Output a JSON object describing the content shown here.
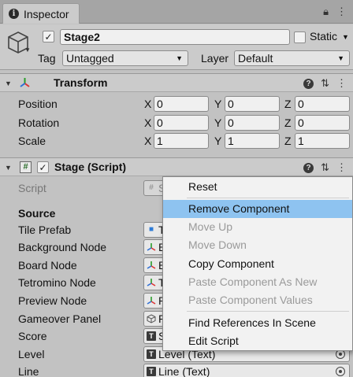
{
  "window": {
    "tab_label": "Inspector"
  },
  "gameobject": {
    "name": "Stage2",
    "active": true,
    "static_label": "Static",
    "tag_label": "Tag",
    "tag_value": "Untagged",
    "layer_label": "Layer",
    "layer_value": "Default"
  },
  "transform": {
    "title": "Transform",
    "rows": [
      {
        "label": "Position",
        "x": "0",
        "y": "0",
        "z": "0"
      },
      {
        "label": "Rotation",
        "x": "0",
        "y": "0",
        "z": "0"
      },
      {
        "label": "Scale",
        "x": "1",
        "y": "1",
        "z": "1"
      }
    ],
    "axes": {
      "x": "X",
      "y": "Y",
      "z": "Z"
    }
  },
  "stage_script": {
    "title": "Stage (Script)",
    "script_label": "Script",
    "script_value": "S",
    "section": "Source",
    "props": [
      {
        "label": "Tile Prefab",
        "value": "T",
        "icon": "prefab-cube-icon"
      },
      {
        "label": "Background Node",
        "value": "B",
        "icon": "transform-icon"
      },
      {
        "label": "Board Node",
        "value": "B",
        "icon": "transform-icon"
      },
      {
        "label": "Tetromino Node",
        "value": "T",
        "icon": "transform-icon"
      },
      {
        "label": "Preview Node",
        "value": "P",
        "icon": "transform-icon"
      },
      {
        "label": "Gameover Panel",
        "value": "P",
        "icon": "gameobject-icon"
      },
      {
        "label": "Score",
        "value": "S",
        "icon": "text-icon"
      },
      {
        "label": "Level",
        "value": "Level (Text)",
        "icon": "text-icon"
      },
      {
        "label": "Line",
        "value": "Line (Text)",
        "icon": "text-icon"
      }
    ]
  },
  "context_menu": {
    "items": [
      {
        "label": "Reset",
        "enabled": true
      },
      {
        "label": "Remove Component",
        "enabled": true,
        "highlighted": true
      },
      {
        "label": "Move Up",
        "enabled": false
      },
      {
        "label": "Move Down",
        "enabled": false
      },
      {
        "label": "Copy Component",
        "enabled": true
      },
      {
        "label": "Paste Component As New",
        "enabled": false
      },
      {
        "label": "Paste Component Values",
        "enabled": false
      },
      {
        "label": "Find References In Scene",
        "enabled": true
      },
      {
        "label": "Edit Script",
        "enabled": true
      }
    ]
  },
  "colors": {
    "menu_highlight": "#8ec3f0",
    "panel_bg": "#c2c2c2"
  }
}
